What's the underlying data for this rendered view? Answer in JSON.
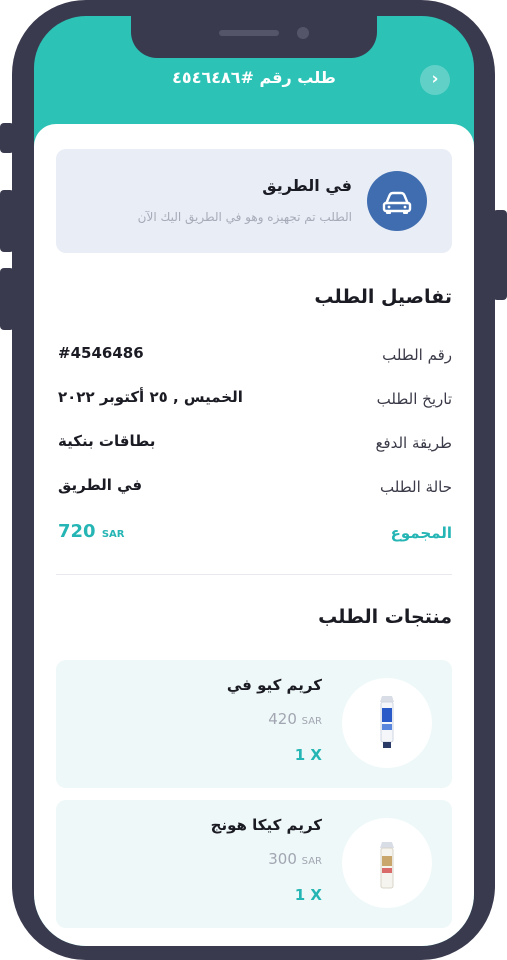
{
  "header": {
    "title": "طلب رقم #٤٥٤٦٤٨٦",
    "back_icon": "chevron-right-icon"
  },
  "status": {
    "title": "في الطريق",
    "subtitle": "الطلب تم تجهيزه وهو في الطريق اليك الآن",
    "icon": "car-icon"
  },
  "details": {
    "section_title": "تفاصيل الطلب",
    "rows": [
      {
        "label": "رقم الطلب",
        "value": "#4546486"
      },
      {
        "label": "تاريخ الطلب",
        "value": "الخميس , ٢٥ أكتوبر ٢٠٢٢"
      },
      {
        "label": "طريقة الدفع",
        "value": "بطاقات بنكية"
      },
      {
        "label": "حالة الطلب",
        "value": "في الطريق"
      }
    ],
    "total_label": "المجموع",
    "total_amount": "720",
    "total_currency": "SAR"
  },
  "products": {
    "section_title": "منتجات الطلب",
    "items": [
      {
        "name": "كريم كيو في",
        "price": "420",
        "currency": "SAR",
        "qty": "1 X"
      },
      {
        "name": "كريم كيكا هونج",
        "price": "300",
        "currency": "SAR",
        "qty": "1 X"
      }
    ]
  },
  "colors": {
    "accent": "#2cc2b6",
    "frame": "#3a3a4f",
    "status_icon_bg": "#3f6db0",
    "status_card_bg": "#e8edf6",
    "product_card_bg": "#eef8f8"
  }
}
